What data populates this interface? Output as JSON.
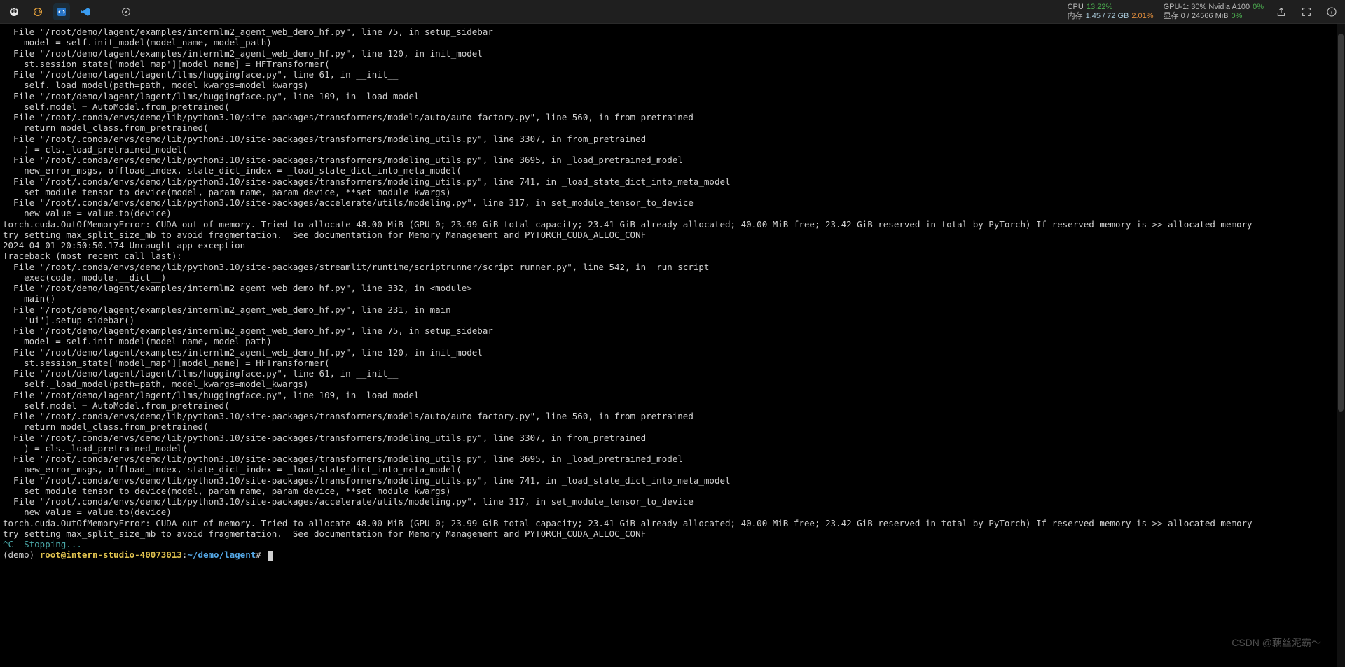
{
  "titlebar": {
    "icons_left": [
      "owl-icon",
      "brackets-icon",
      "code-icon",
      "vscode-icon",
      "compass-icon"
    ],
    "stats": {
      "cpu_label": "CPU",
      "cpu_pct": "13.22%",
      "mem_label": "内存",
      "mem_used": "1.45 / 72 GB",
      "mem_pct": "2.01%",
      "gpu_label": "GPU-1: 30% Nvidia A100",
      "gpu_pct": "0%",
      "vram_label": "显存 0 / 24566 MiB",
      "vram_pct": "0%"
    },
    "icons_right": [
      "share-icon",
      "expand-icon",
      "info-icon"
    ]
  },
  "terminal_lines": [
    "  File \"/root/demo/lagent/examples/internlm2_agent_web_demo_hf.py\", line 75, in setup_sidebar",
    "    model = self.init_model(model_name, model_path)",
    "  File \"/root/demo/lagent/examples/internlm2_agent_web_demo_hf.py\", line 120, in init_model",
    "    st.session_state['model_map'][model_name] = HFTransformer(",
    "  File \"/root/demo/lagent/lagent/llms/huggingface.py\", line 61, in __init__",
    "    self._load_model(path=path, model_kwargs=model_kwargs)",
    "  File \"/root/demo/lagent/lagent/llms/huggingface.py\", line 109, in _load_model",
    "    self.model = AutoModel.from_pretrained(",
    "  File \"/root/.conda/envs/demo/lib/python3.10/site-packages/transformers/models/auto/auto_factory.py\", line 560, in from_pretrained",
    "    return model_class.from_pretrained(",
    "  File \"/root/.conda/envs/demo/lib/python3.10/site-packages/transformers/modeling_utils.py\", line 3307, in from_pretrained",
    "    ) = cls._load_pretrained_model(",
    "  File \"/root/.conda/envs/demo/lib/python3.10/site-packages/transformers/modeling_utils.py\", line 3695, in _load_pretrained_model",
    "    new_error_msgs, offload_index, state_dict_index = _load_state_dict_into_meta_model(",
    "  File \"/root/.conda/envs/demo/lib/python3.10/site-packages/transformers/modeling_utils.py\", line 741, in _load_state_dict_into_meta_model",
    "    set_module_tensor_to_device(model, param_name, param_device, **set_module_kwargs)",
    "  File \"/root/.conda/envs/demo/lib/python3.10/site-packages/accelerate/utils/modeling.py\", line 317, in set_module_tensor_to_device",
    "    new_value = value.to(device)",
    "torch.cuda.OutOfMemoryError: CUDA out of memory. Tried to allocate 48.00 MiB (GPU 0; 23.99 GiB total capacity; 23.41 GiB already allocated; 40.00 MiB free; 23.42 GiB reserved in total by PyTorch) If reserved memory is >> allocated memory",
    "try setting max_split_size_mb to avoid fragmentation.  See documentation for Memory Management and PYTORCH_CUDA_ALLOC_CONF",
    "2024-04-01 20:50:50.174 Uncaught app exception",
    "Traceback (most recent call last):",
    "  File \"/root/.conda/envs/demo/lib/python3.10/site-packages/streamlit/runtime/scriptrunner/script_runner.py\", line 542, in _run_script",
    "    exec(code, module.__dict__)",
    "  File \"/root/demo/lagent/examples/internlm2_agent_web_demo_hf.py\", line 332, in <module>",
    "    main()",
    "  File \"/root/demo/lagent/examples/internlm2_agent_web_demo_hf.py\", line 231, in main",
    "    'ui'].setup_sidebar()",
    "  File \"/root/demo/lagent/examples/internlm2_agent_web_demo_hf.py\", line 75, in setup_sidebar",
    "    model = self.init_model(model_name, model_path)",
    "  File \"/root/demo/lagent/examples/internlm2_agent_web_demo_hf.py\", line 120, in init_model",
    "    st.session_state['model_map'][model_name] = HFTransformer(",
    "  File \"/root/demo/lagent/lagent/llms/huggingface.py\", line 61, in __init__",
    "    self._load_model(path=path, model_kwargs=model_kwargs)",
    "  File \"/root/demo/lagent/lagent/llms/huggingface.py\", line 109, in _load_model",
    "    self.model = AutoModel.from_pretrained(",
    "  File \"/root/.conda/envs/demo/lib/python3.10/site-packages/transformers/models/auto/auto_factory.py\", line 560, in from_pretrained",
    "    return model_class.from_pretrained(",
    "  File \"/root/.conda/envs/demo/lib/python3.10/site-packages/transformers/modeling_utils.py\", line 3307, in from_pretrained",
    "    ) = cls._load_pretrained_model(",
    "  File \"/root/.conda/envs/demo/lib/python3.10/site-packages/transformers/modeling_utils.py\", line 3695, in _load_pretrained_model",
    "    new_error_msgs, offload_index, state_dict_index = _load_state_dict_into_meta_model(",
    "  File \"/root/.conda/envs/demo/lib/python3.10/site-packages/transformers/modeling_utils.py\", line 741, in _load_state_dict_into_meta_model",
    "    set_module_tensor_to_device(model, param_name, param_device, **set_module_kwargs)",
    "  File \"/root/.conda/envs/demo/lib/python3.10/site-packages/accelerate/utils/modeling.py\", line 317, in set_module_tensor_to_device",
    "    new_value = value.to(device)",
    "torch.cuda.OutOfMemoryError: CUDA out of memory. Tried to allocate 48.00 MiB (GPU 0; 23.99 GiB total capacity; 23.41 GiB already allocated; 40.00 MiB free; 23.42 GiB reserved in total by PyTorch) If reserved memory is >> allocated memory",
    "try setting max_split_size_mb to avoid fragmentation.  See documentation for Memory Management and PYTORCH_CUDA_ALLOC_CONF"
  ],
  "stopping_line": "^C  Stopping...",
  "prompt": {
    "env": "(demo) ",
    "userhost": "root@intern-studio-40073013",
    "sep": ":",
    "path": "~/demo/lagent",
    "hash": "# "
  },
  "watermark": "CSDN @藕丝泥霸～"
}
